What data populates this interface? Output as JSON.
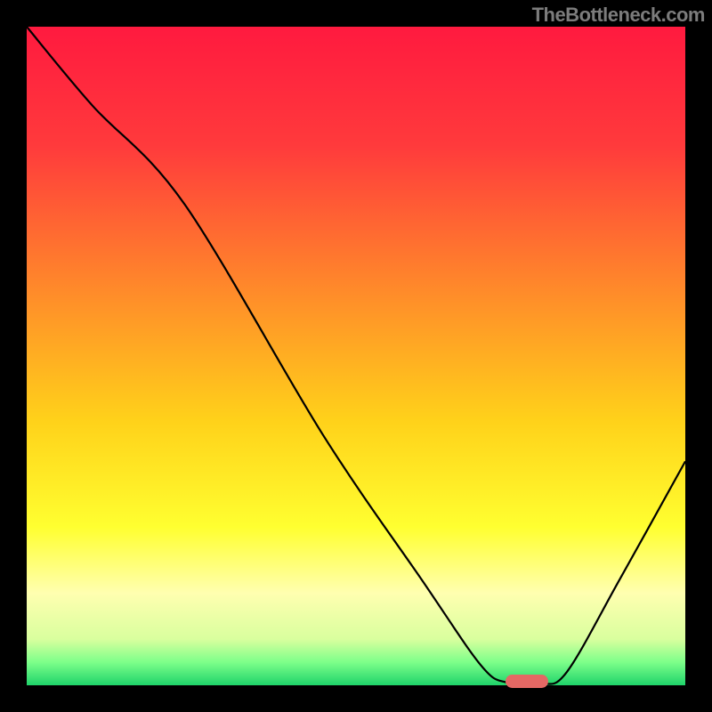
{
  "attribution": "TheBottleneck.com",
  "chart_data": {
    "type": "line",
    "title": "",
    "xlabel": "",
    "ylabel": "",
    "xlim": [
      0,
      100
    ],
    "ylim": [
      0,
      100
    ],
    "background_gradient_stops": [
      {
        "offset": 0,
        "color": "#ff1a3f"
      },
      {
        "offset": 0.18,
        "color": "#ff3a3c"
      },
      {
        "offset": 0.4,
        "color": "#ff8a2a"
      },
      {
        "offset": 0.6,
        "color": "#ffd21a"
      },
      {
        "offset": 0.76,
        "color": "#ffff30"
      },
      {
        "offset": 0.86,
        "color": "#ffffb0"
      },
      {
        "offset": 0.93,
        "color": "#d9ff9e"
      },
      {
        "offset": 0.965,
        "color": "#7dff8a"
      },
      {
        "offset": 1.0,
        "color": "#1fd36a"
      }
    ],
    "series": [
      {
        "name": "curve",
        "points": [
          {
            "x": 0,
            "y": 100
          },
          {
            "x": 10,
            "y": 88
          },
          {
            "x": 24,
            "y": 73
          },
          {
            "x": 45,
            "y": 38
          },
          {
            "x": 60,
            "y": 16
          },
          {
            "x": 69,
            "y": 3
          },
          {
            "x": 73,
            "y": 0.4
          },
          {
            "x": 78,
            "y": 0.2
          },
          {
            "x": 82,
            "y": 2
          },
          {
            "x": 90,
            "y": 16
          },
          {
            "x": 100,
            "y": 34
          }
        ]
      }
    ],
    "marker": {
      "x": 76,
      "y": 0.7,
      "color": "#e46864"
    }
  }
}
